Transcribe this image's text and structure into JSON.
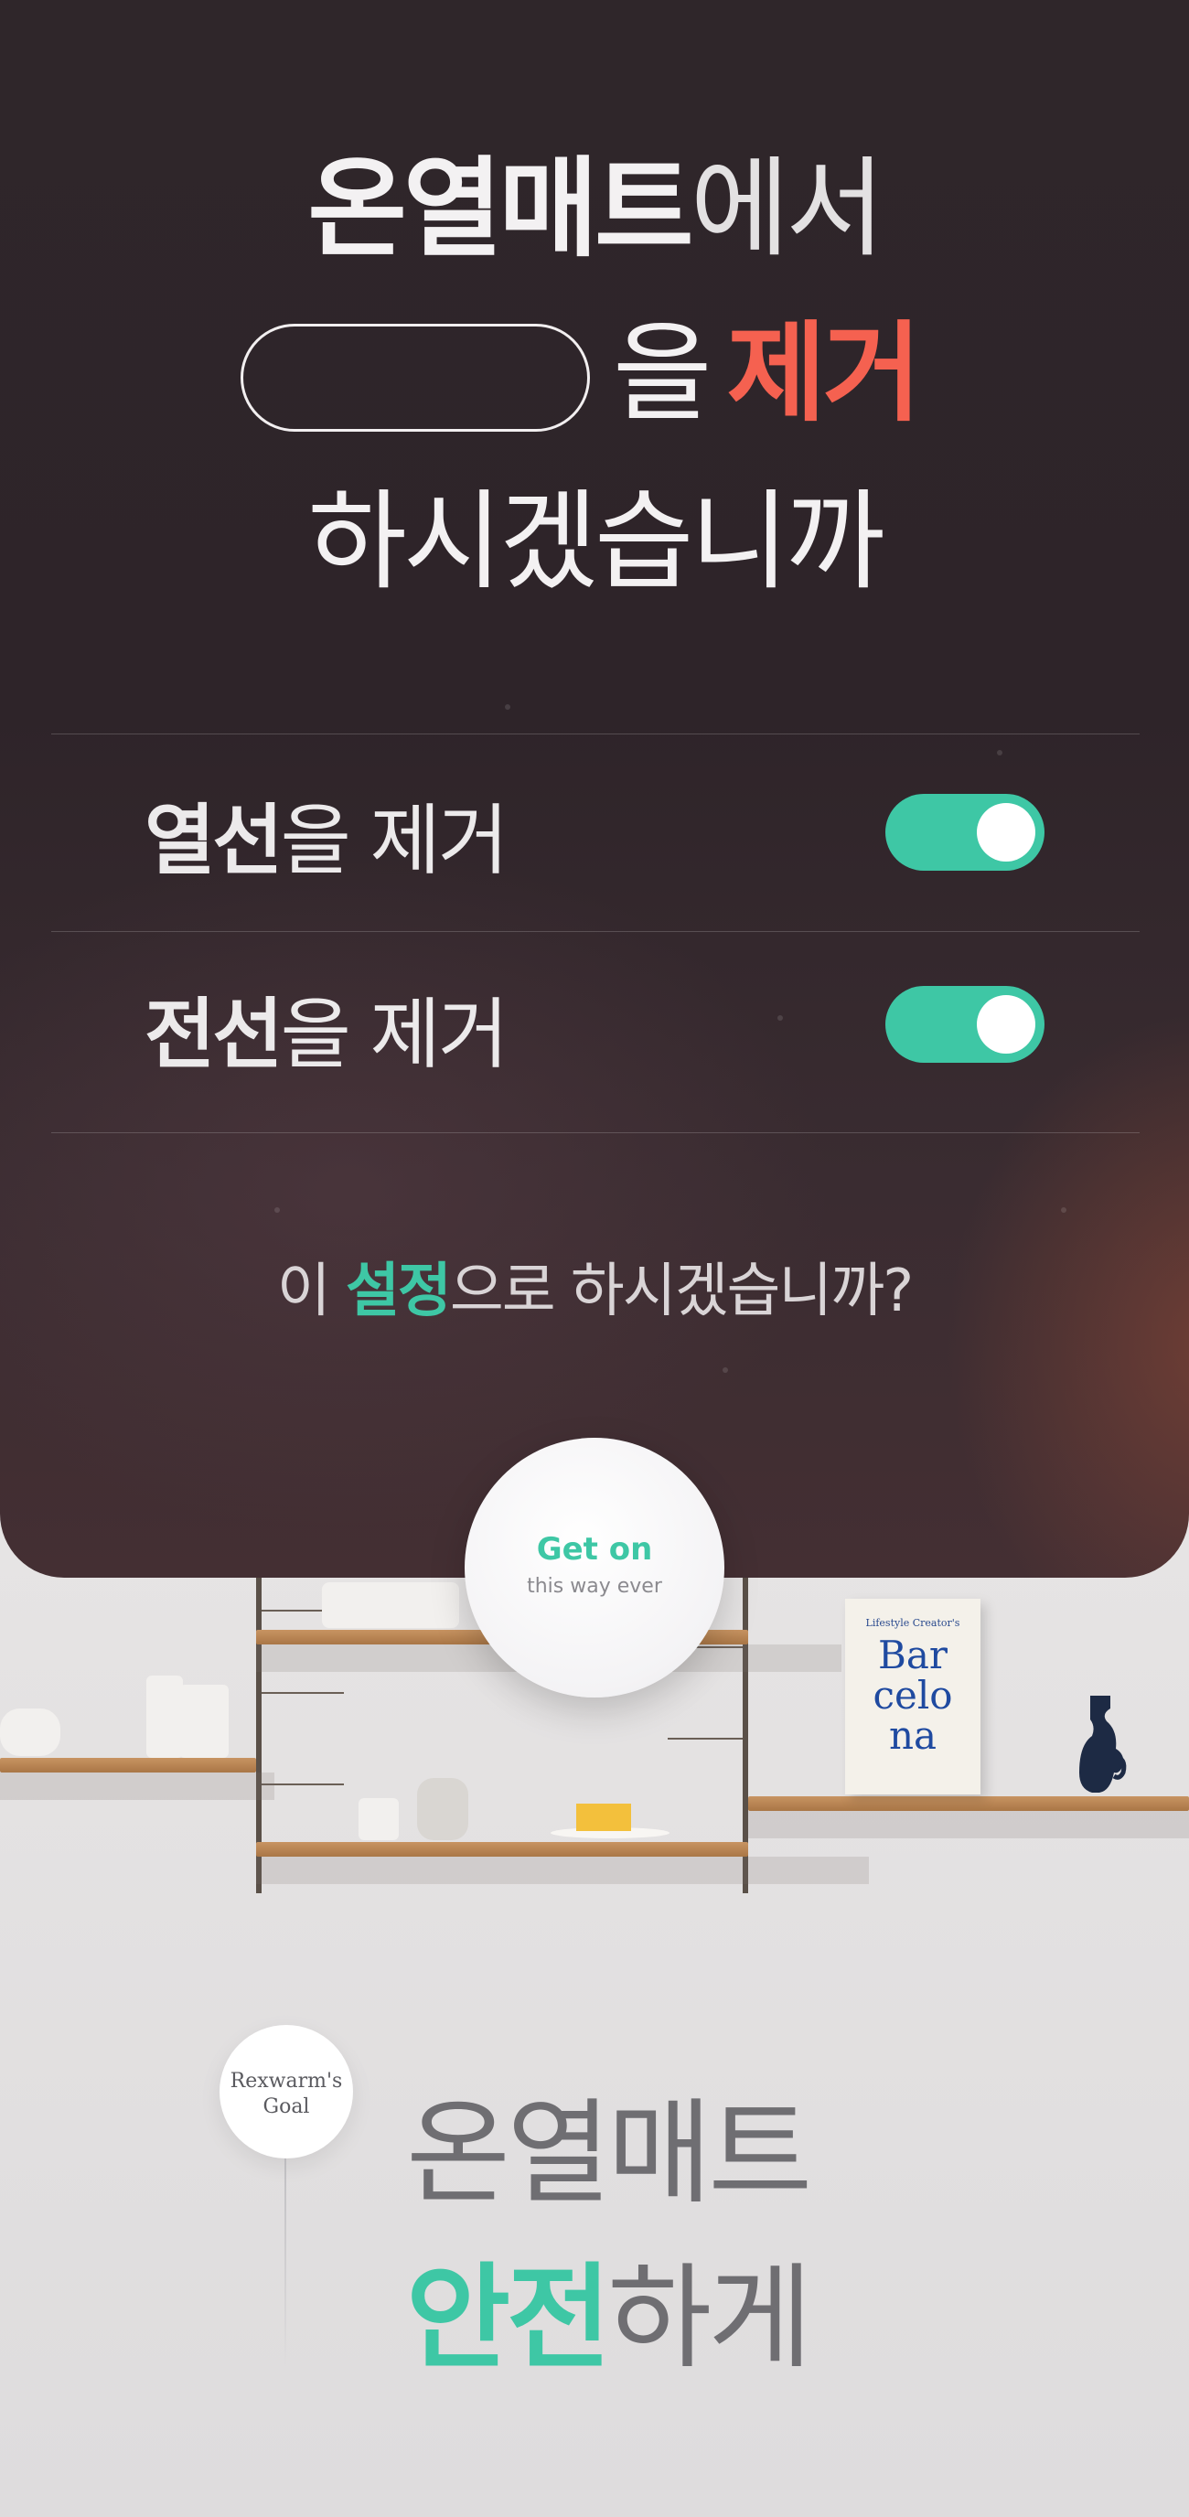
{
  "header": {
    "line1_bold": "온열매트",
    "line1_light": "에서",
    "line2_light": "을",
    "line2_accent": "제거",
    "line3": "하시겠습니까"
  },
  "options": [
    {
      "bold": "열선",
      "rest": "을 제거",
      "enabled": true
    },
    {
      "bold": "전선",
      "rest": "을 제거",
      "enabled": true
    }
  ],
  "question": {
    "prefix": "이 ",
    "highlight": "설정",
    "suffix": "으로 하시겠습니까?"
  },
  "cta": {
    "title": "Get on",
    "subtitle": "this way ever"
  },
  "book": {
    "top_text": "Lifestyle Creator's",
    "title_lines": [
      "Bar",
      "celo",
      "na"
    ]
  },
  "goal": {
    "line1": "Rexwarm's",
    "line2": "Goal"
  },
  "bottom": {
    "line1": "온열매트",
    "line2_highlight": "안전",
    "line2_rest": "하게"
  },
  "colors": {
    "accent_teal": "#3ec7a5",
    "accent_red": "#f56150",
    "panel_dark": "#2f262a"
  }
}
